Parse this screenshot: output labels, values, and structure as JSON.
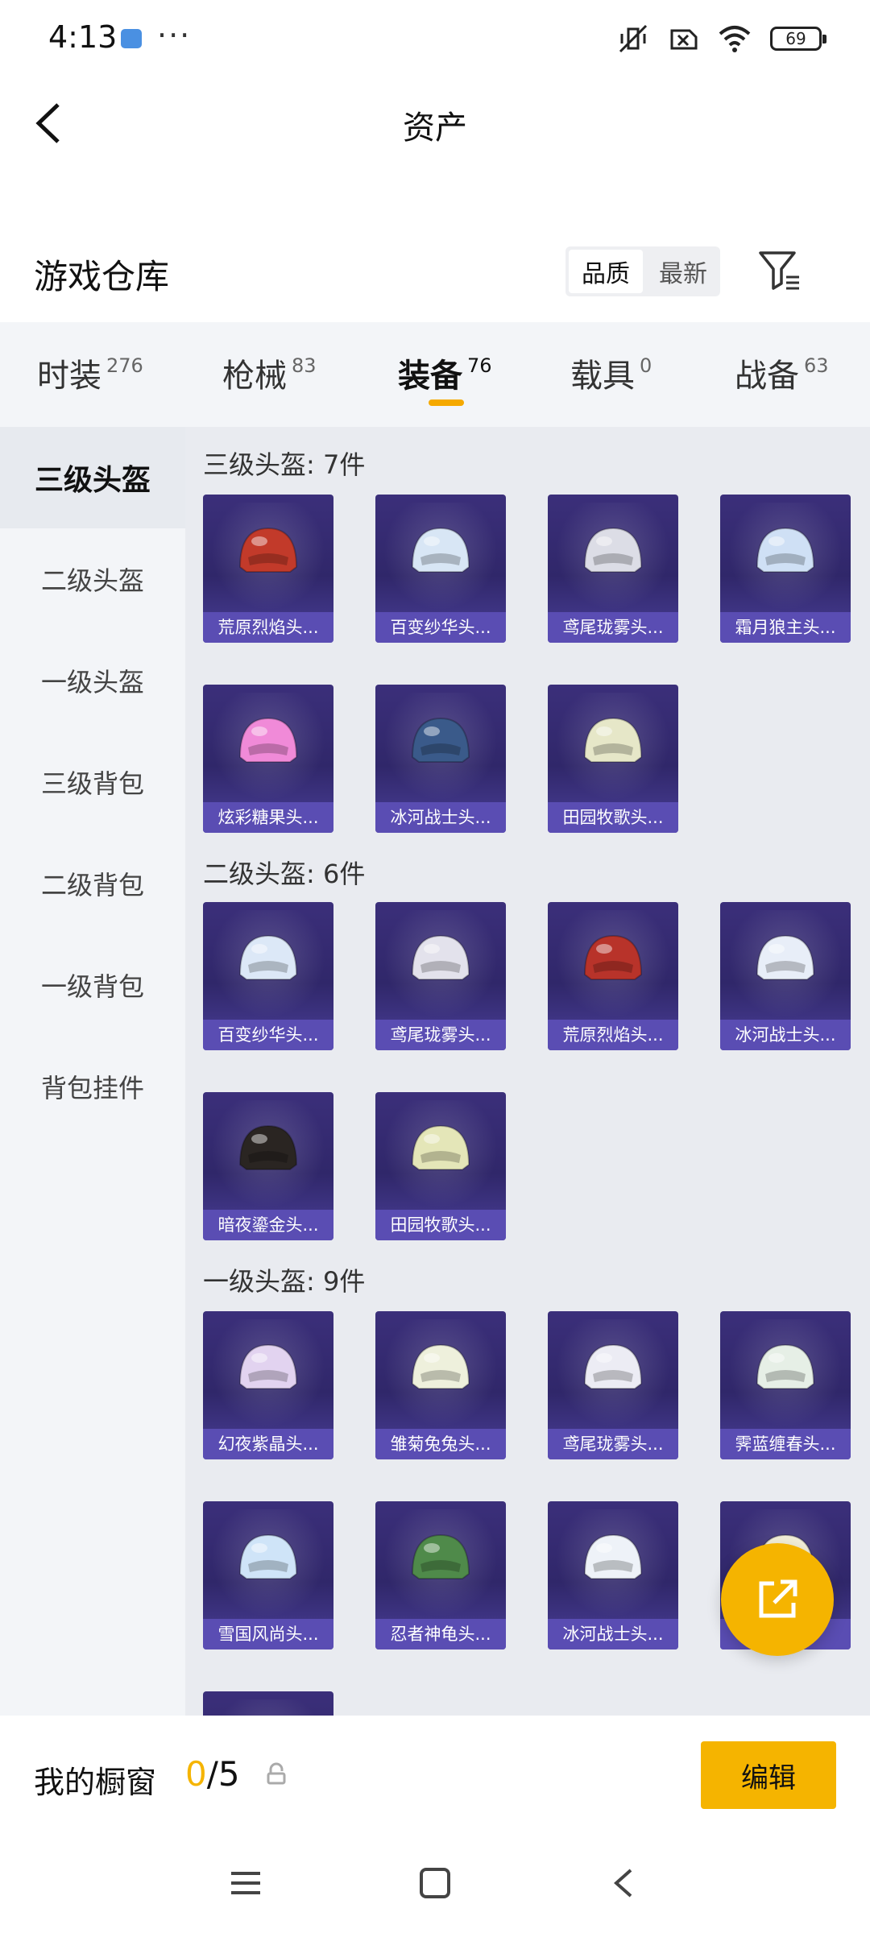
{
  "status": {
    "time": "4:13",
    "more": "···",
    "battery": "69"
  },
  "header": {
    "title": "资产"
  },
  "section": {
    "title": "游戏仓库",
    "sort_options": [
      "品质",
      "最新"
    ]
  },
  "tabs": [
    {
      "label": "时装",
      "count": "276"
    },
    {
      "label": "枪械",
      "count": "83"
    },
    {
      "label": "装备",
      "count": "76"
    },
    {
      "label": "载具",
      "count": "0"
    },
    {
      "label": "战备",
      "count": "63"
    }
  ],
  "sidebar": {
    "items": [
      {
        "label": "三级头盔"
      },
      {
        "label": "二级头盔"
      },
      {
        "label": "一级头盔"
      },
      {
        "label": "三级背包"
      },
      {
        "label": "二级背包"
      },
      {
        "label": "一级背包"
      },
      {
        "label": "背包挂件"
      }
    ]
  },
  "groups": [
    {
      "title": "三级头盔: 7件",
      "items": [
        {
          "name": "荒原烈焰头...",
          "color": "#c23a2a"
        },
        {
          "name": "百变纱华头...",
          "color": "#d8e6f5"
        },
        {
          "name": "鸢尾珑雾头...",
          "color": "#dcdde6"
        },
        {
          "name": "霜月狼主头...",
          "color": "#cfe0f5"
        },
        {
          "name": "炫彩糖果头...",
          "color": "#f08ad8"
        },
        {
          "name": "冰河战士头...",
          "color": "#3a5a8a"
        },
        {
          "name": "田园牧歌头...",
          "color": "#e6e7c8"
        }
      ]
    },
    {
      "title": "二级头盔: 6件",
      "items": [
        {
          "name": "百变纱华头...",
          "color": "#dce8f7"
        },
        {
          "name": "鸢尾珑雾头...",
          "color": "#e3e2ec"
        },
        {
          "name": "荒原烈焰头...",
          "color": "#b8332a"
        },
        {
          "name": "冰河战士头...",
          "color": "#e8eef8"
        },
        {
          "name": "暗夜鎏金头...",
          "color": "#2a2522"
        },
        {
          "name": "田园牧歌头...",
          "color": "#e4e6b8"
        }
      ]
    },
    {
      "title": "一级头盔: 9件",
      "items": [
        {
          "name": "幻夜紫晶头...",
          "color": "#e2d3f0"
        },
        {
          "name": "雏菊兔兔头...",
          "color": "#eef0dc"
        },
        {
          "name": "鸢尾珑雾头...",
          "color": "#ececf4"
        },
        {
          "name": "霁蓝缠春头...",
          "color": "#e6efe6"
        },
        {
          "name": "雪国风尚头...",
          "color": "#cfe4f8"
        },
        {
          "name": "忍者神龟头...",
          "color": "#4f8a4a"
        },
        {
          "name": "冰河战士头...",
          "color": "#eef2f8"
        },
        {
          "name": "",
          "color": "#f2eed8"
        }
      ]
    }
  ],
  "showcase": {
    "label": "我的橱窗",
    "current": "0",
    "total": "/5",
    "edit_label": "编辑"
  },
  "colors": {
    "accent": "#f5b400",
    "card_bg": "#30276a",
    "card_label_bg": "#5a4db3"
  }
}
